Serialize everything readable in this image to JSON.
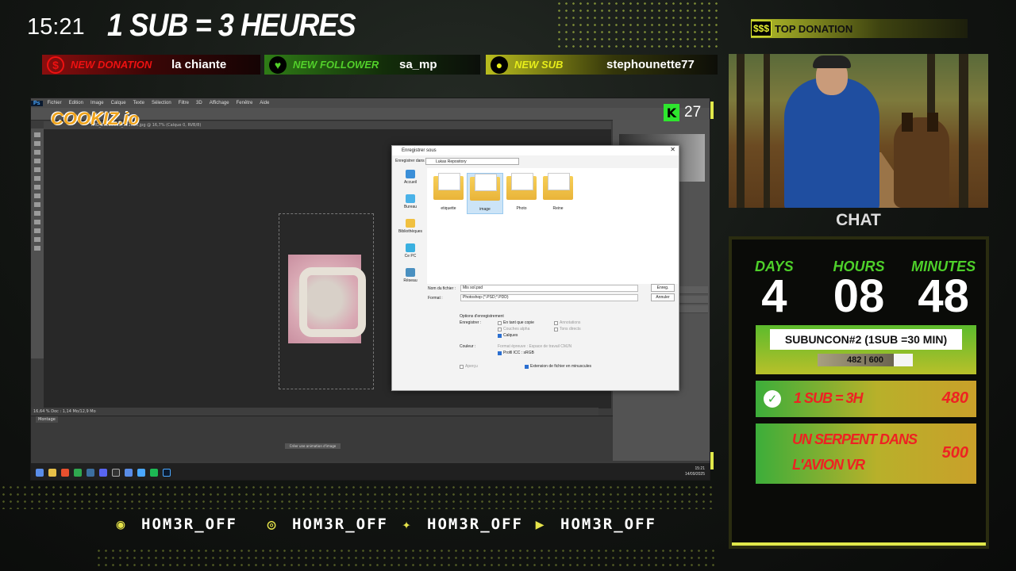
{
  "overlay": {
    "clock": "15:21",
    "headline": "1 SUB = 3 HEURES",
    "alerts": [
      {
        "tag": "NEW DONATION",
        "value": "la chiante",
        "icon": "dollar-icon"
      },
      {
        "tag": "NEW FOLLOWER",
        "value": "sa_mp",
        "icon": "heart-icon"
      },
      {
        "tag": "NEW SUB",
        "value": "stephounette77",
        "icon": "users-icon"
      }
    ],
    "top_donation": {
      "badge": "$$$",
      "label": "TOP DONATION"
    },
    "cookiz": "COOKIZ.io",
    "kick": {
      "icon": "K",
      "viewers": "27"
    },
    "chat_label": "CHAT",
    "timer": {
      "days_label": "DAYS",
      "days": "4",
      "hours_label": "HOURS",
      "hours": "08",
      "minutes_label": "MINUTES",
      "minutes": "48"
    },
    "subgoal": {
      "title": "SUBUNCON#2 (1SUB =30 MIN)",
      "progress_text": "482 | 600",
      "progress": 0.803
    },
    "rewards": [
      {
        "text": "1 SUB = 3H",
        "value": "480",
        "done": true
      },
      {
        "text1": "UN SERPENT DANS",
        "text2": "L'AVION VR",
        "value": "500"
      }
    ],
    "socials": [
      {
        "icon": "discord-icon",
        "handle": "HOM3R_OFF"
      },
      {
        "icon": "instagram-icon",
        "handle": "HOM3R_OFF"
      },
      {
        "icon": "twitter-icon",
        "handle": "HOM3R_OFF"
      },
      {
        "icon": "youtube-icon",
        "handle": "HOM3R_OFF"
      }
    ]
  },
  "photoshop": {
    "menu": [
      "Fichier",
      "Edition",
      "Image",
      "Calque",
      "Texte",
      "Sélection",
      "Filtre",
      "3D",
      "Affichage",
      "Fenêtre",
      "Aide"
    ],
    "doc_tab": "IMG_20250908_121626.jpg @ 16,7% (Calque 0, RVB/8)",
    "status": "16,64 %      Doc : 1,14 Mo/12,9 Mo",
    "timeline_tab": "Montage",
    "timeline_button": "Créer une animation d'image",
    "taskbar_time": "15:21",
    "taskbar_date": "14/09/2025"
  },
  "dialog": {
    "title": "Enregistrer sous",
    "save_in_label": "Enregistrer dans :",
    "path": "Lukas Repository",
    "nav": [
      "Accueil",
      "Bureau",
      "Bibliothèques",
      "Ce PC",
      "Réseau"
    ],
    "folders": [
      "etiquette",
      "image",
      "Photo",
      "Reine"
    ],
    "filename_label": "Nom du fichier :",
    "filename": "Mis sol.psd",
    "format_label": "Format :",
    "format": "Photoshop (*.PSD;*.PDD)",
    "save_button": "Enreg.",
    "cancel_button": "Annuler",
    "options_title": "Options d'enregistrement",
    "save_label": "Enregistrer :",
    "as_copy": "En tant que copie",
    "annotations": "Annotations",
    "alpha": "Couches alpha",
    "spot": "Tons directs",
    "layers": "Calques",
    "color_label": "Couleur :",
    "proof": "Format épreuve : Espace de travail CMJN",
    "icc": "Profil ICC : sRGB",
    "thumbnail": "Aperçu",
    "lowercase_ext": "Extension de fichier en minuscules"
  }
}
